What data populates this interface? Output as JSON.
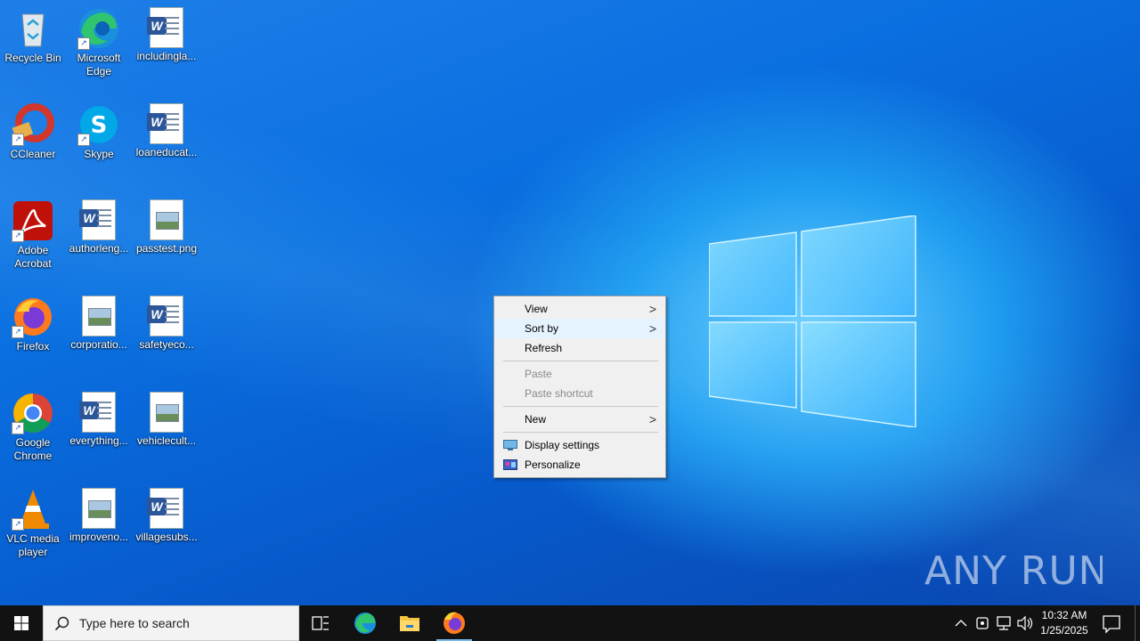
{
  "desktop_icons": [
    {
      "name": "Recycle Bin"
    },
    {
      "name": "Microsoft Edge"
    },
    {
      "name": "includingla..."
    },
    {
      "name": "CCleaner"
    },
    {
      "name": "Skype"
    },
    {
      "name": "loaneducat..."
    },
    {
      "name": "Adobe Acrobat"
    },
    {
      "name": "authorleng..."
    },
    {
      "name": "passtest.png"
    },
    {
      "name": "Firefox"
    },
    {
      "name": "corporatio..."
    },
    {
      "name": "safetyeco..."
    },
    {
      "name": "Google Chrome"
    },
    {
      "name": "everything..."
    },
    {
      "name": "vehiclecult..."
    },
    {
      "name": "VLC media player"
    },
    {
      "name": "improveno..."
    },
    {
      "name": "villagesubs..."
    }
  ],
  "context_menu": {
    "items": [
      {
        "label": "View",
        "submenu": true
      },
      {
        "label": "Sort by",
        "submenu": true,
        "highlighted": true
      },
      {
        "label": "Refresh"
      },
      {
        "label": "Paste",
        "disabled": true
      },
      {
        "label": "Paste shortcut",
        "disabled": true
      },
      {
        "label": "New",
        "submenu": true
      },
      {
        "label": "Display settings",
        "icon": "display-icon"
      },
      {
        "label": "Personalize",
        "icon": "personalize-icon"
      }
    ],
    "submenu_glyph": ">"
  },
  "taskbar": {
    "search_placeholder": "Type here to search",
    "pinned": [
      "task-view-icon",
      "edge-icon",
      "file-explorer-icon",
      "firefox-icon"
    ],
    "clock_time": "10:32 AM",
    "clock_date": "1/25/2025"
  },
  "watermark": "ANY RUN",
  "colors": {
    "accent": "#0078d7",
    "taskbar": "#121212",
    "menu_bg": "#f0f0f0",
    "menu_hover": "#e5f3ff"
  }
}
